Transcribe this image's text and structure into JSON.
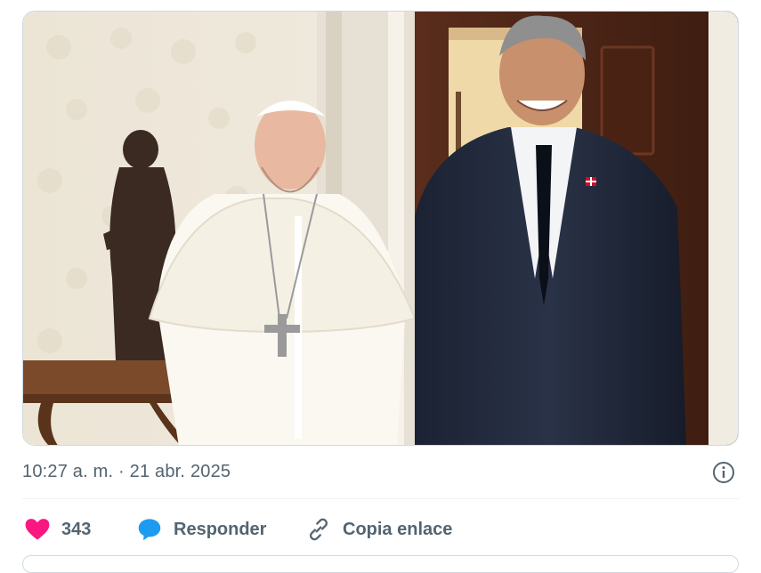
{
  "tweet": {
    "photo": {
      "alt": "",
      "icon": "photo"
    },
    "timestamp": "10:27 a. m. · 21 abr. 2025",
    "info_icon": "info-icon"
  },
  "actions": {
    "like": {
      "icon": "heart-icon",
      "count": "343",
      "color": "#f91880"
    },
    "reply": {
      "icon": "speech-bubble-icon",
      "label": "Responder",
      "color": "#1d9bf0"
    },
    "copy": {
      "icon": "link-icon",
      "label": "Copia enlace"
    }
  },
  "colors": {
    "secondary_text": "#536471",
    "border": "#cfd9de"
  }
}
